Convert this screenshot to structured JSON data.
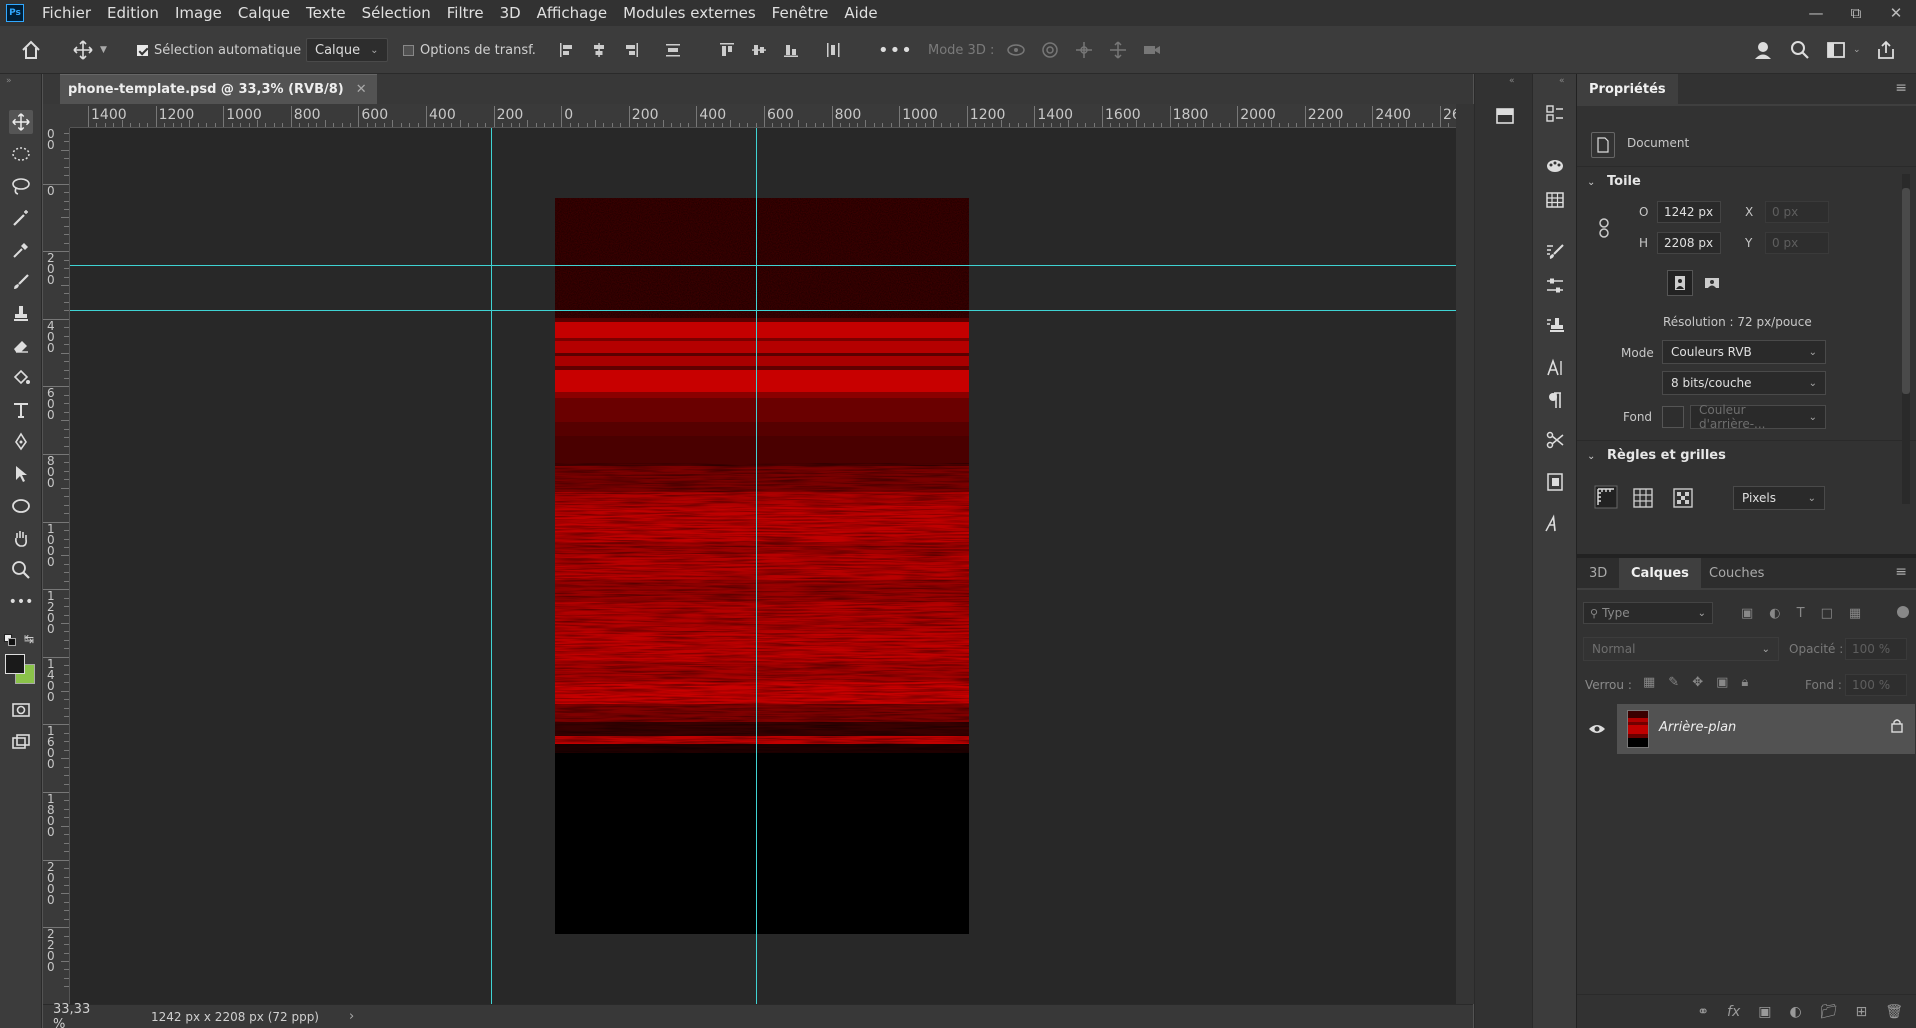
{
  "app": {
    "logo": "Ps",
    "menu": [
      "Fichier",
      "Edition",
      "Image",
      "Calque",
      "Texte",
      "Sélection",
      "Filtre",
      "3D",
      "Affichage",
      "Modules externes",
      "Fenêtre",
      "Aide"
    ]
  },
  "options_bar": {
    "auto_select_label": "Sélection automatique :",
    "auto_select_checked": true,
    "auto_select_target": "Calque",
    "transform_options_label": "Options de transf.",
    "mode3d_label": "Mode 3D :"
  },
  "document": {
    "tab_title": "phone-template.psd @ 33,3% (RVB/8)",
    "zoom": "33,33 %",
    "size_info": "1242 px x 2208 px (72 ppp)"
  },
  "rulers": {
    "horizontal": [
      "1400",
      "1200",
      "1000",
      "800",
      "600",
      "400",
      "200",
      "0",
      "200",
      "400",
      "600",
      "800",
      "1000",
      "1200",
      "1400",
      "1600",
      "1800",
      "2000",
      "2200",
      "2400",
      "2600"
    ],
    "vertical": [
      "2\n0\n0",
      "0",
      "2\n0\n0",
      "4\n0\n0",
      "6\n0\n0",
      "8\n0\n0",
      "1\n0\n0\n0",
      "1\n2\n0\n0",
      "1\n4\n0\n0",
      "1\n6\n0\n0",
      "1\n8\n0\n0",
      "2\n0\n0\n0",
      "2\n2\n0\n0"
    ]
  },
  "properties": {
    "title": "Propriétés",
    "doc_label": "Document",
    "canvas_section": "Toile",
    "width_label": "O",
    "width_value": "1242 px",
    "height_label": "H",
    "height_value": "2208 px",
    "x_label": "X",
    "x_placeholder": "0 px",
    "y_label": "Y",
    "y_placeholder": "0 px",
    "resolution": "Résolution : 72 px/pouce",
    "mode_label": "Mode",
    "mode_value": "Couleurs RVB",
    "depth_value": "8 bits/couche",
    "fond_label": "Fond",
    "fond_value": "Couleur d'arrière-...",
    "rulers_section": "Règles et grilles",
    "units_value": "Pixels"
  },
  "layers_panel": {
    "tabs": [
      "3D",
      "Calques",
      "Couches"
    ],
    "active_tab": "Calques",
    "filter_placeholder": "Type",
    "blend_mode": "Normal",
    "opacity_label": "Opacité :",
    "opacity_value": "100 %",
    "lock_label": "Verrou :",
    "fill_label": "Fond :",
    "fill_value": "100 %",
    "layers": [
      {
        "name": "Arrière-plan",
        "visible": true,
        "locked": true
      }
    ]
  },
  "colors": {
    "foreground": "#1a1a1a",
    "background": "#8bc34a",
    "guide": "#3fd4d4",
    "accent_red": "#cc0000"
  }
}
